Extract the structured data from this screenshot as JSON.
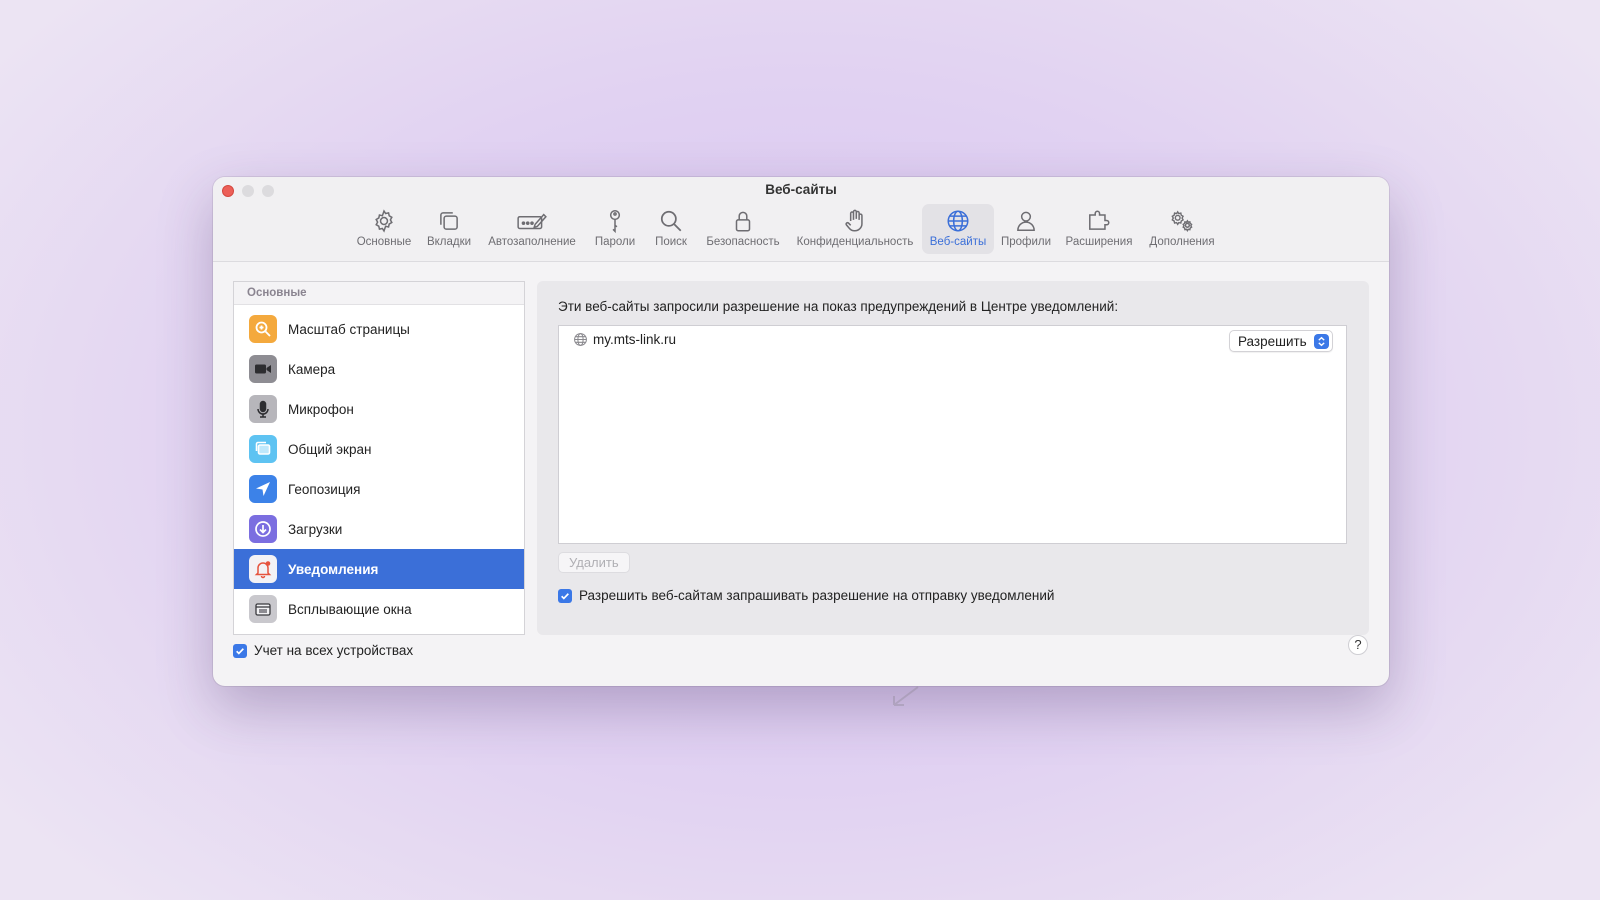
{
  "window": {
    "title": "Веб-сайты"
  },
  "toolbar": [
    {
      "label": "Основные",
      "icon": "gear-icon"
    },
    {
      "label": "Вкладки",
      "icon": "tabs-icon"
    },
    {
      "label": "Автозаполнение",
      "icon": "autofill-icon"
    },
    {
      "label": "Пароли",
      "icon": "key-icon"
    },
    {
      "label": "Поиск",
      "icon": "search-icon"
    },
    {
      "label": "Безопасность",
      "icon": "lock-icon"
    },
    {
      "label": "Конфиденциальность",
      "icon": "hand-icon"
    },
    {
      "label": "Веб-сайты",
      "icon": "globe-icon",
      "active": true
    },
    {
      "label": "Профили",
      "icon": "person-icon"
    },
    {
      "label": "Расширения",
      "icon": "puzzle-icon"
    },
    {
      "label": "Дополнения",
      "icon": "gears-icon"
    }
  ],
  "sidebar": {
    "header": "Основные",
    "items": [
      {
        "label": "Масштаб страницы",
        "icon": "zoom-icon"
      },
      {
        "label": "Камера",
        "icon": "camera-icon"
      },
      {
        "label": "Микрофон",
        "icon": "microphone-icon"
      },
      {
        "label": "Общий экран",
        "icon": "screen-share-icon"
      },
      {
        "label": "Геопозиция",
        "icon": "location-icon"
      },
      {
        "label": "Загрузки",
        "icon": "download-icon"
      },
      {
        "label": "Уведомления",
        "icon": "notification-bell-icon",
        "selected": true
      },
      {
        "label": "Всплывающие окна",
        "icon": "popup-window-icon"
      }
    ]
  },
  "panel": {
    "description": "Эти веб-сайты запросили разрешение на показ предупреждений в Центре уведомлений:",
    "sites": [
      {
        "domain": "my.mts-link.ru",
        "permission": "Разрешить"
      }
    ],
    "delete_label": "Удалить",
    "allow_requests_label": "Разрешить веб-сайтам запрашивать разрешение на отправку уведомлений",
    "allow_requests_checked": true
  },
  "footer": {
    "sync_label": "Учет на всех устройствах",
    "sync_checked": true,
    "help_label": "?"
  },
  "colors": {
    "accent": "#3b6fd8",
    "close": "#ec5f58"
  }
}
